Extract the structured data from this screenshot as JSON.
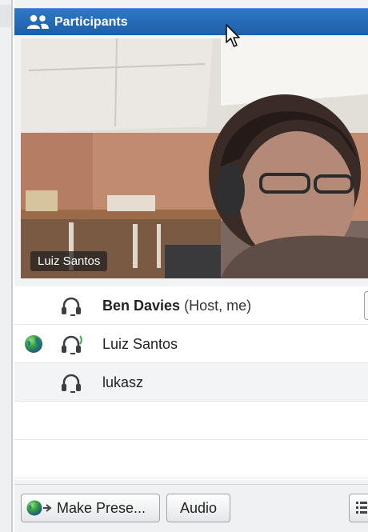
{
  "panel": {
    "title": "Participants",
    "title_icon": "participants-icon"
  },
  "video": {
    "participant_label": "Luiz Santos"
  },
  "participants": [
    {
      "name": "Ben Davies",
      "role": "(Host, me)",
      "status_icon": "",
      "audio_icon": "headset-icon",
      "speaking": false
    },
    {
      "name": "Luiz Santos",
      "role": "",
      "status_icon": "globe-icon",
      "audio_icon": "headset-speaking-icon",
      "speaking": true
    },
    {
      "name": "lukasz",
      "role": "",
      "status_icon": "",
      "audio_icon": "headset-icon",
      "speaking": false
    }
  ],
  "toolbar": {
    "make_presenter_label": "Make Prese...",
    "audio_label": "Audio"
  },
  "colors": {
    "title_bar": "#1d5ea8",
    "speaking_indicator": "#3ab14a"
  }
}
